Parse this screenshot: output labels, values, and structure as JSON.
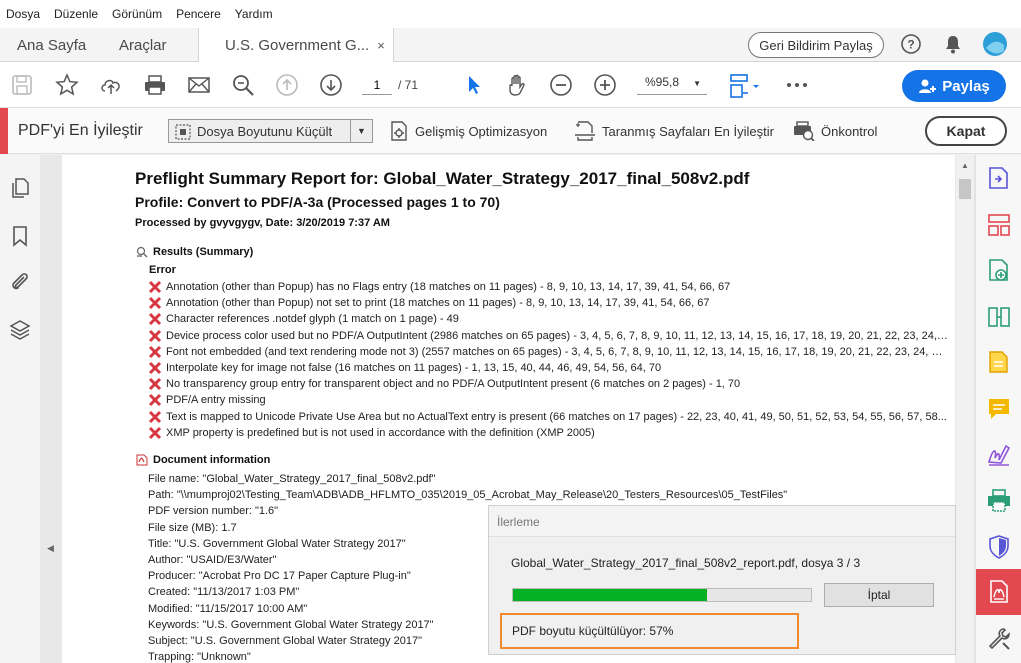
{
  "menu": [
    "Dosya",
    "Düzenle",
    "Görünüm",
    "Pencere",
    "Yardım"
  ],
  "tabs": {
    "home": "Ana Sayfa",
    "tools": "Araçlar",
    "document": "U.S. Government G...",
    "close_glyph": "×"
  },
  "header": {
    "feedback": "Geri Bildirim Paylaş"
  },
  "toolbar": {
    "page_current": "1",
    "page_total": "/ 71",
    "zoom": "%95,8",
    "share": "Paylaş"
  },
  "optimize": {
    "title": "PDF'yi En İyileştir",
    "reduce_size": "Dosya Boyutunu Küçült",
    "advanced": "Gelişmiş Optimizasyon",
    "scanned": "Taranmış Sayfaları En İyileştir",
    "preflight": "Önkontrol",
    "close": "Kapat"
  },
  "report": {
    "title": "Preflight Summary Report for: Global_Water_Strategy_2017_final_508v2.pdf",
    "profile": "Profile: Convert to PDF/A-3a (Processed pages 1 to 70)",
    "processed": "Processed by gvyvgygv, Date: 3/20/2019 7:37 AM",
    "results_heading": "Results (Summary)",
    "error_heading": "Error",
    "errors": [
      "Annotation (other than Popup) has no Flags entry (18 matches on 11 pages) - 8, 9, 10, 13, 14, 17, 39, 41, 54, 66, 67",
      "Annotation (other than Popup) not set to print (18 matches on 11 pages) - 8, 9, 10, 13, 14, 17, 39, 41, 54, 66, 67",
      "Character references .notdef glyph (1 match on 1 page) - 49",
      "Device process color used but no PDF/A OutputIntent (2986 matches on 65 pages) - 3, 4, 5, 6, 7, 8, 9, 10, 11, 12, 13, 14, 15, 16, 17, 18, 19, 20, 21, 22, 23, 24, 25...",
      "Font not embedded (and text rendering mode not 3) (2557 matches on 65 pages) - 3, 4, 5, 6, 7, 8, 9, 10, 11, 12, 13, 14, 15, 16, 17, 18, 19, 20, 21, 22, 23, 24, 25...",
      "Interpolate key for image not false (16 matches on 11 pages) - 1, 13, 15, 40, 44, 46, 49, 54, 56, 64, 70",
      "No transparency group entry for transparent object and no PDF/A OutputIntent present (6 matches on 2 pages) - 1, 70",
      "PDF/A entry missing",
      "Text is mapped to Unicode Private Use Area but no ActualText entry is present (66 matches on 17 pages) - 22, 23, 40, 41, 49, 50, 51, 52, 53, 54, 55, 56, 57, 58...",
      "XMP property is predefined but is not used in accordance with the definition (XMP 2005)"
    ],
    "docinfo_heading": "Document information",
    "docinfo": [
      "File name: \"Global_Water_Strategy_2017_final_508v2.pdf\"",
      "Path: \"\\\\mumproj02\\Testing_Team\\ADB\\ADB_HFLMTO_035\\2019_05_Acrobat_May_Release\\20_Testers_Resources\\05_TestFiles\"",
      "PDF version number: \"1.6\"",
      "File size (MB): 1.7",
      "Title: \"U.S. Government Global Water Strategy 2017\"",
      "Author: \"USAID/E3/Water\"",
      "Producer: \"Acrobat Pro DC 17 Paper Capture Plug-in\"",
      "Created: \"11/13/2017 1:03 PM\"",
      "Modified: \"11/15/2017 10:00 AM\"",
      "Keywords: \"U.S. Government Global Water Strategy 2017\"",
      "Subject: \"U.S. Government Global Water Strategy 2017\"",
      "Trapping: \"Unknown\""
    ]
  },
  "progress_dialog": {
    "title": "İlerleme",
    "file_text": "Global_Water_Strategy_2017_final_508v2_report.pdf, dosya 3 / 3",
    "progress_fraction": 0.65,
    "cancel": "İptal",
    "status": "PDF boyutu küçültülüyor: 57%"
  },
  "colors": {
    "accent_blue": "#1473e6",
    "accent_red": "#e34850",
    "error_red": "#d7373f",
    "progress_green": "#06b025",
    "highlight_orange": "#f08a2c"
  }
}
